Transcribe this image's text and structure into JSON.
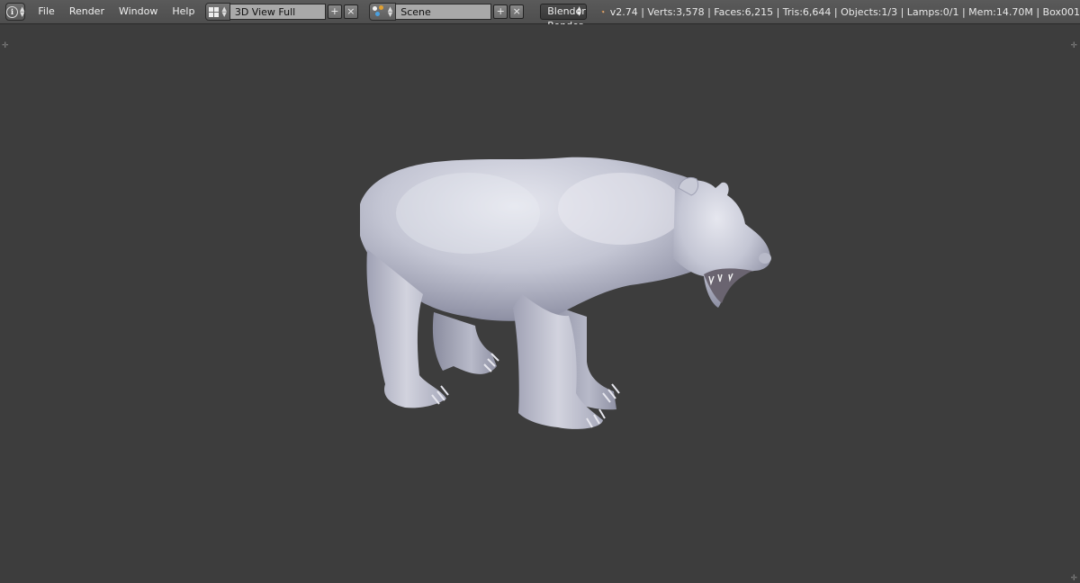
{
  "header": {
    "editor_type_icon": "info-icon",
    "menu": [
      "File",
      "Render",
      "Window",
      "Help"
    ],
    "screen_layout": {
      "icon": "layout-grid-icon",
      "value": "3D View Full"
    },
    "scene": {
      "icon": "scene-icon",
      "value": "Scene"
    },
    "render_engine": "Blender Render",
    "blender_logo_icon": "blender-logo-icon",
    "stats": "v2.74 | Verts:3,578 | Faces:6,215 | Tris:6,644 | Objects:1/3 | Lamps:0/1 | Mem:14.70M | Box001"
  },
  "viewport": {
    "background": "#3d3d3d",
    "model": "bear-model",
    "model_color": "#c8cad6"
  }
}
